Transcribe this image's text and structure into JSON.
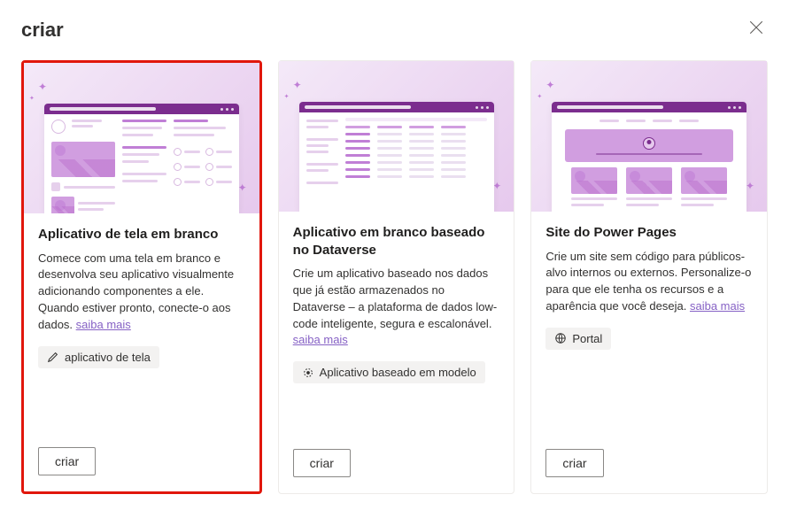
{
  "header": {
    "title": "criar"
  },
  "cards": [
    {
      "title": "Aplicativo de tela em branco",
      "desc": "Comece com uma tela em branco e desenvolva seu aplicativo visualmente adicionando componentes a ele. Quando estiver pronto, conecte-o aos dados. ",
      "learn_more": "saiba mais",
      "tag": "aplicativo de tela",
      "create": "criar",
      "highlighted": true
    },
    {
      "title": "Aplicativo em branco baseado no Dataverse",
      "desc": "Crie um aplicativo baseado nos dados que já estão armazenados no Dataverse – a plataforma de dados low-code inteligente, segura e escalonável. ",
      "learn_more": "saiba mais",
      "tag": "Aplicativo baseado em modelo",
      "create": "criar",
      "highlighted": false
    },
    {
      "title": "Site do Power Pages",
      "desc": "Crie um site sem código para públicos-alvo internos ou externos. Personalize-o para que ele tenha os recursos e a aparência que você deseja. ",
      "learn_more": "saiba mais",
      "tag": "Portal",
      "create": "criar",
      "highlighted": false
    }
  ]
}
